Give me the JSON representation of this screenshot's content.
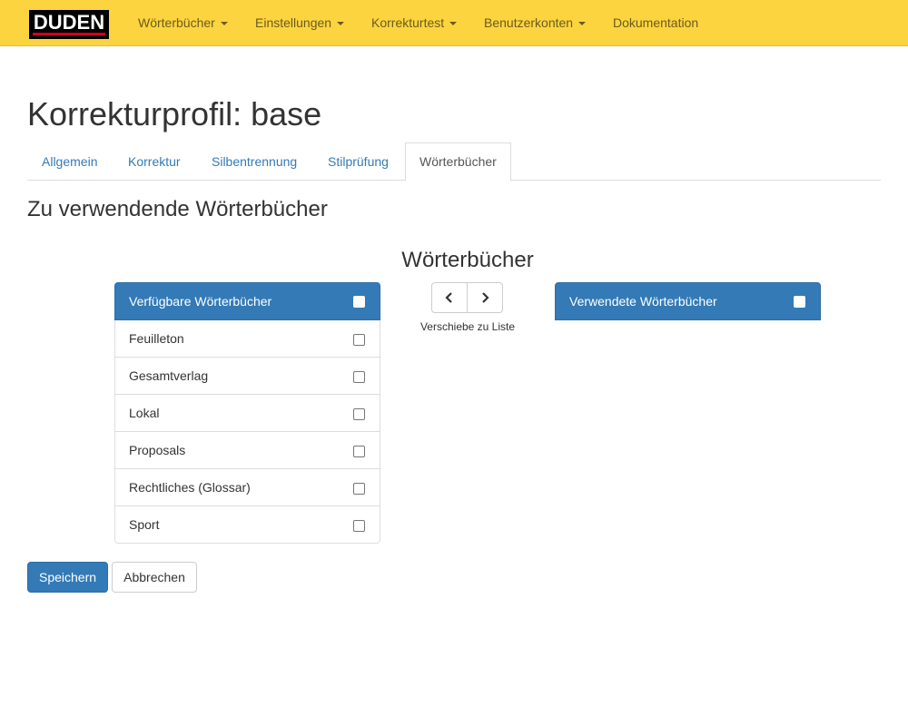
{
  "navbar": {
    "logo_text": "DUDEN",
    "items": [
      {
        "label": "Wörterbücher",
        "dropdown": true
      },
      {
        "label": "Einstellungen",
        "dropdown": true
      },
      {
        "label": "Korrekturtest",
        "dropdown": true
      },
      {
        "label": "Benutzerkonten",
        "dropdown": true
      },
      {
        "label": "Dokumentation",
        "dropdown": false
      }
    ]
  },
  "page": {
    "title": "Korrekturprofil: base",
    "tabs": [
      {
        "label": "Allgemein",
        "active": false
      },
      {
        "label": "Korrektur",
        "active": false
      },
      {
        "label": "Silbentrennung",
        "active": false
      },
      {
        "label": "Stilprüfung",
        "active": false
      },
      {
        "label": "Wörterbücher",
        "active": true
      }
    ],
    "section_title": "Zu verwendende Wörterbücher",
    "center_title": "Wörterbücher"
  },
  "available": {
    "header": "Verfügbare Wörterbücher",
    "items": [
      "Feuilleton",
      "Gesamtverlag",
      "Lokal",
      "Proposals",
      "Rechtliches (Glossar)",
      "Sport"
    ]
  },
  "used": {
    "header": "Verwendete Wörterbücher",
    "items": []
  },
  "move": {
    "hint": "Verschiebe zu Liste",
    "left_icon": "chevron-left-icon",
    "right_icon": "chevron-right-icon"
  },
  "actions": {
    "save_label": "Speichern",
    "cancel_label": "Abbrechen"
  },
  "colors": {
    "navbar_bg": "#fcd440",
    "primary": "#337ab7",
    "link": "#337ab7"
  }
}
